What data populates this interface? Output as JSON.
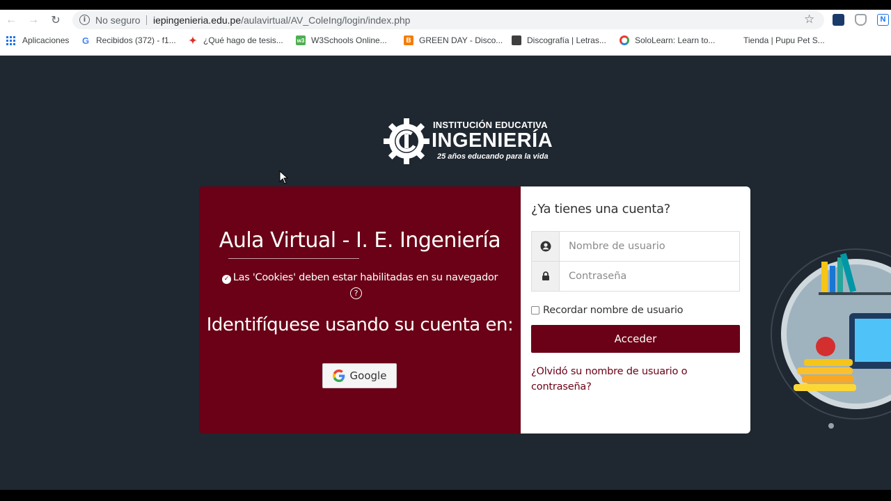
{
  "browser": {
    "security_label": "No seguro",
    "url_host": "iepingenieria.edu.pe",
    "url_path": "/aulavirtual/AV_ColeIng/login/index.php",
    "bookmarks": [
      {
        "label": "Aplicaciones",
        "icon": "apps-icon"
      },
      {
        "label": "Recibidos (372) - f1...",
        "icon": "google-icon"
      },
      {
        "label": "¿Qué hago de tesis...",
        "icon": "star-favicon"
      },
      {
        "label": "W3Schools Online...",
        "icon": "w3schools-icon"
      },
      {
        "label": "GREEN DAY - Disco...",
        "icon": "blogger-icon"
      },
      {
        "label": "Discografía | Letras...",
        "icon": "album-icon"
      },
      {
        "label": "SoloLearn: Learn to...",
        "icon": "sololearn-icon"
      },
      {
        "label": "Tienda | Pupu Pet S...",
        "icon": "blank-icon"
      }
    ]
  },
  "logo": {
    "line1": "INSTITUCIÓN EDUCATIVA",
    "line2": "INGENIERÍA",
    "line3": "25 años educando para la vida"
  },
  "login_left": {
    "title": "Aula Virtual - I. E. Ingeniería",
    "cookies_notice": "Las 'Cookies' deben estar habilitadas en su navegador",
    "identify_text": "Identifíquese usando su cuenta en:",
    "google_label": "Google"
  },
  "login_right": {
    "heading": "¿Ya tienes una cuenta?",
    "username_placeholder": "Nombre de usuario",
    "password_placeholder": "Contraseña",
    "remember_label": "Recordar nombre de usuario",
    "submit_label": "Acceder",
    "forgot_label": "¿Olvidó su nombre de usuario o contraseña?"
  },
  "colors": {
    "page_bg": "#1f2730",
    "brand": "#6a0116",
    "card_right_bg": "#ffffff"
  }
}
